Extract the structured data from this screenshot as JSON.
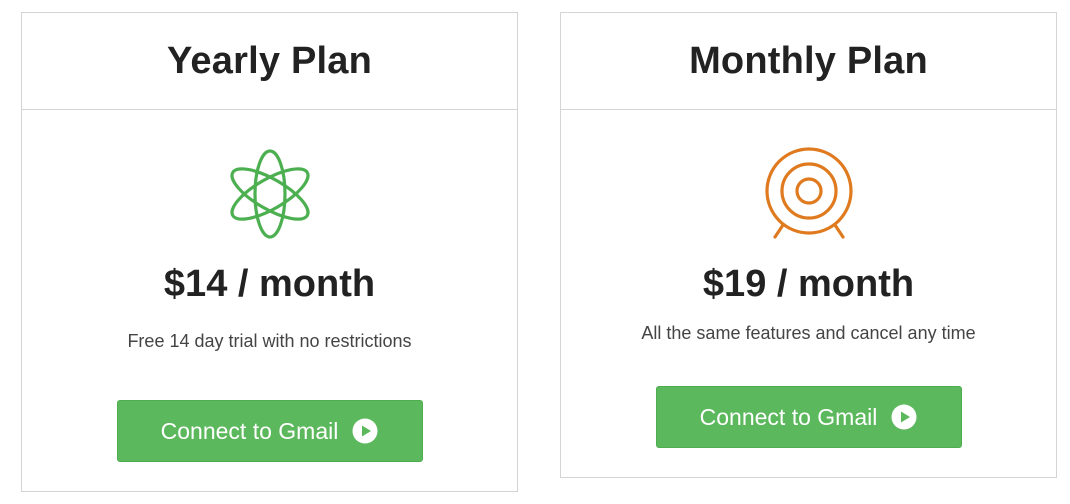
{
  "plans": [
    {
      "title": "Yearly Plan",
      "icon": "atom-icon",
      "icon_color": "#4caf50",
      "price": "$14 / month",
      "description": "Free 14 day trial with no restrictions",
      "button_label": "Connect to Gmail",
      "button_icon": "play-circle-icon"
    },
    {
      "title": "Monthly Plan",
      "icon": "target-icon",
      "icon_color": "#e07a1f",
      "price": "$19 / month",
      "description": "All the same features and cancel any time",
      "button_label": "Connect to Gmail",
      "button_icon": "play-circle-icon"
    }
  ],
  "colors": {
    "button_bg": "#5cb85c",
    "border": "#d4d4d4",
    "text": "#222222"
  }
}
